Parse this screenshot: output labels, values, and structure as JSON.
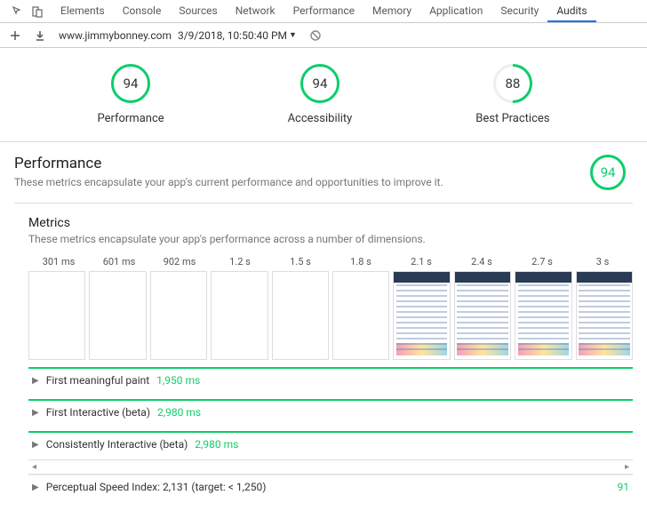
{
  "tabs": {
    "items": [
      "Elements",
      "Console",
      "Sources",
      "Network",
      "Performance",
      "Memory",
      "Application",
      "Security",
      "Audits"
    ],
    "active": "Audits"
  },
  "toolbar": {
    "url": "www.jimmybonney.com",
    "timestamp": "3/9/2018, 10:50:40 PM"
  },
  "summary": {
    "scores": [
      {
        "value": "94",
        "label": "Performance",
        "full": true
      },
      {
        "value": "94",
        "label": "Accessibility",
        "full": true
      },
      {
        "value": "88",
        "label": "Best Practices",
        "full": false
      }
    ]
  },
  "section": {
    "title": "Performance",
    "desc": "These metrics encapsulate your app's current performance and opportunities to improve it.",
    "score": "94"
  },
  "metrics": {
    "title": "Metrics",
    "desc": "These metrics encapsulate your app's performance across a number of dimensions.",
    "timeline_labels": [
      "301 ms",
      "601 ms",
      "902 ms",
      "1.2 s",
      "1.5 s",
      "1.8 s",
      "2.1 s",
      "2.4 s",
      "2.7 s",
      "3 s"
    ],
    "frames_loaded_from": 6,
    "rows": [
      {
        "name": "First meaningful paint",
        "value": "1,950 ms",
        "color": "green"
      },
      {
        "name": "First Interactive (beta)",
        "value": "2,980 ms",
        "color": "green"
      },
      {
        "name": "Consistently Interactive (beta)",
        "value": "2,980 ms",
        "color": "green"
      }
    ],
    "psi": {
      "label": "Perceptual Speed Index: 2,131 (target: < 1,250)",
      "score": "91"
    }
  }
}
